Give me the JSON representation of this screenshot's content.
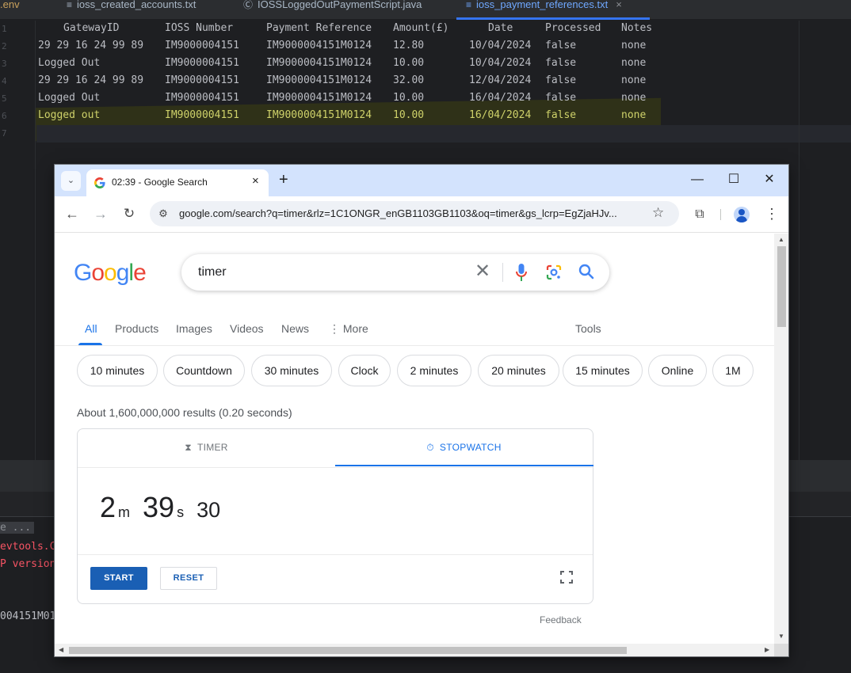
{
  "ide": {
    "tabs": [
      {
        "label": ".env"
      },
      {
        "label": "ioss_created_accounts.txt"
      },
      {
        "label": "IOSSLoggedOutPaymentScript.java"
      },
      {
        "label": "ioss_payment_references.txt",
        "close": "×"
      }
    ],
    "line_numbers": [
      "1",
      "2",
      "3",
      "4",
      "5",
      "6",
      "7"
    ],
    "header": [
      "GatewayID",
      "IOSS Number",
      "Payment Reference",
      "Amount(£)",
      "Date",
      "Processed",
      "Notes"
    ],
    "rows": [
      [
        "29 29 16 24 99 89",
        "IM9000004151",
        "IM9000004151M0124",
        "12.80",
        "10/04/2024",
        "false",
        "none"
      ],
      [
        "Logged Out",
        "IM9000004151",
        "IM9000004151M0124",
        "10.00",
        "10/04/2024",
        "false",
        "none"
      ],
      [
        "29 29 16 24 99 89",
        "IM9000004151",
        "IM9000004151M0124",
        "32.00",
        "12/04/2024",
        "false",
        "none"
      ],
      [
        "Logged Out",
        "IM9000004151",
        "IM9000004151M0124",
        "10.00",
        "16/04/2024",
        "false",
        "none"
      ],
      [
        "Logged out",
        "IM9000004151",
        "IM9000004151M0124",
        "10.00",
        "16/04/2024",
        "false",
        "none"
      ]
    ],
    "console": {
      "line1": "e ...",
      "line2": "evtools.C",
      "line3": "P version",
      "line4": "004151M01"
    }
  },
  "chrome": {
    "tab_title": "02:39 - Google Search",
    "tab_close": "×",
    "new_tab": "+",
    "url": "google.com/search?q=timer&rlz=1C1ONGR_enGB1103GB1103&oq=timer&gs_lcrp=EgZjaHJv...",
    "window_controls": {
      "minimize": "—",
      "maximize": "☐",
      "close": "✕"
    }
  },
  "google": {
    "logo": {
      "l1": "G",
      "l2": "o",
      "l3": "o",
      "l4": "g",
      "l5": "l",
      "l6": "e"
    },
    "query": "timer",
    "tabs": {
      "all": "All",
      "products": "Products",
      "images": "Images",
      "videos": "Videos",
      "news": "News",
      "more": "More",
      "tools": "Tools"
    },
    "chips": [
      "10 minutes",
      "Countdown",
      "30 minutes",
      "Clock",
      "2 minutes",
      "20 minutes",
      "15 minutes",
      "Online",
      "1M"
    ],
    "result_stats": "About 1,600,000,000 results (0.20 seconds)",
    "timer": {
      "tab_timer": "TIMER",
      "tab_stopwatch": "STOPWATCH",
      "minutes": "2",
      "minutes_unit": "m",
      "seconds": "39",
      "seconds_unit": "s",
      "centiseconds": "30",
      "start": "START",
      "reset": "RESET"
    },
    "feedback": "Feedback"
  },
  "colors": {
    "accent_blue": "#1a73e8",
    "start_button": "#1a5fb4",
    "ide_highlight_text": "#cfd26a"
  }
}
